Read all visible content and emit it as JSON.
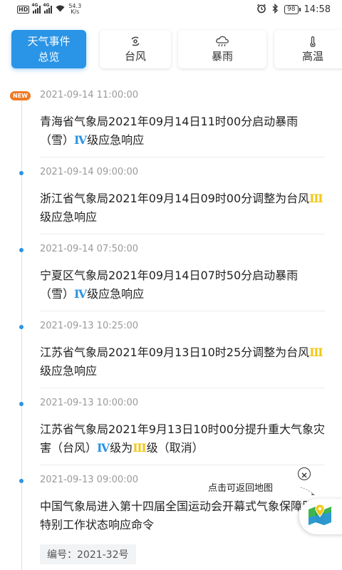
{
  "status_bar": {
    "net_speed_value": "54.3",
    "net_speed_unit": "K/s",
    "battery": "98",
    "time": "14:58",
    "hd": "HD",
    "sim_tag": "4G"
  },
  "tabs": [
    {
      "line1": "天气事件",
      "line2": "总览",
      "active": true
    },
    {
      "label": "台风",
      "icon": "typhoon-icon"
    },
    {
      "label": "暴雨",
      "icon": "rain-cloud-icon"
    },
    {
      "label": "高温",
      "icon": "thermometer-icon"
    }
  ],
  "new_badge": "NEW",
  "events": [
    {
      "time": "2021-09-14 11:00:00",
      "pre": "青海省气象局2021年09月14日11时00分启动暴雨（雪）",
      "level": "Ⅳ",
      "post": "级应急响应"
    },
    {
      "time": "2021-09-14 09:00:00",
      "pre": "浙江省气象局2021年09月14日09时00分调整为台风",
      "level": "Ⅲ",
      "post": "级应急响应"
    },
    {
      "time": "2021-09-14 07:50:00",
      "pre": "宁夏区气象局2021年09月14日07时50分启动暴雨（雪）",
      "level": "Ⅳ",
      "post": "级应急响应"
    },
    {
      "time": "2021-09-13 10:25:00",
      "pre": "江苏省气象局2021年09月13日10时25分调整为台风",
      "level": "Ⅲ",
      "post": "级应急响应"
    },
    {
      "time": "2021-09-13 10:00:00",
      "pre": "江苏省气象局2021年9月13日10时00分提升重大气象灾害（台风）",
      "level": "Ⅳ",
      "mid": "级为",
      "level2": "Ⅲ",
      "post": "级（取消）"
    },
    {
      "time": "2021-09-13 09:00:00",
      "text": "中国气象局进入第十四届全国运动会开幕式气象保障服务特别工作状态响应命令",
      "code": "编号：2021-32号"
    }
  ],
  "map_hint": "点击可返回地图",
  "colors": {
    "accent": "#2a94e6",
    "level_iii": "#f3c716",
    "new_badge": "#ef7a25"
  }
}
